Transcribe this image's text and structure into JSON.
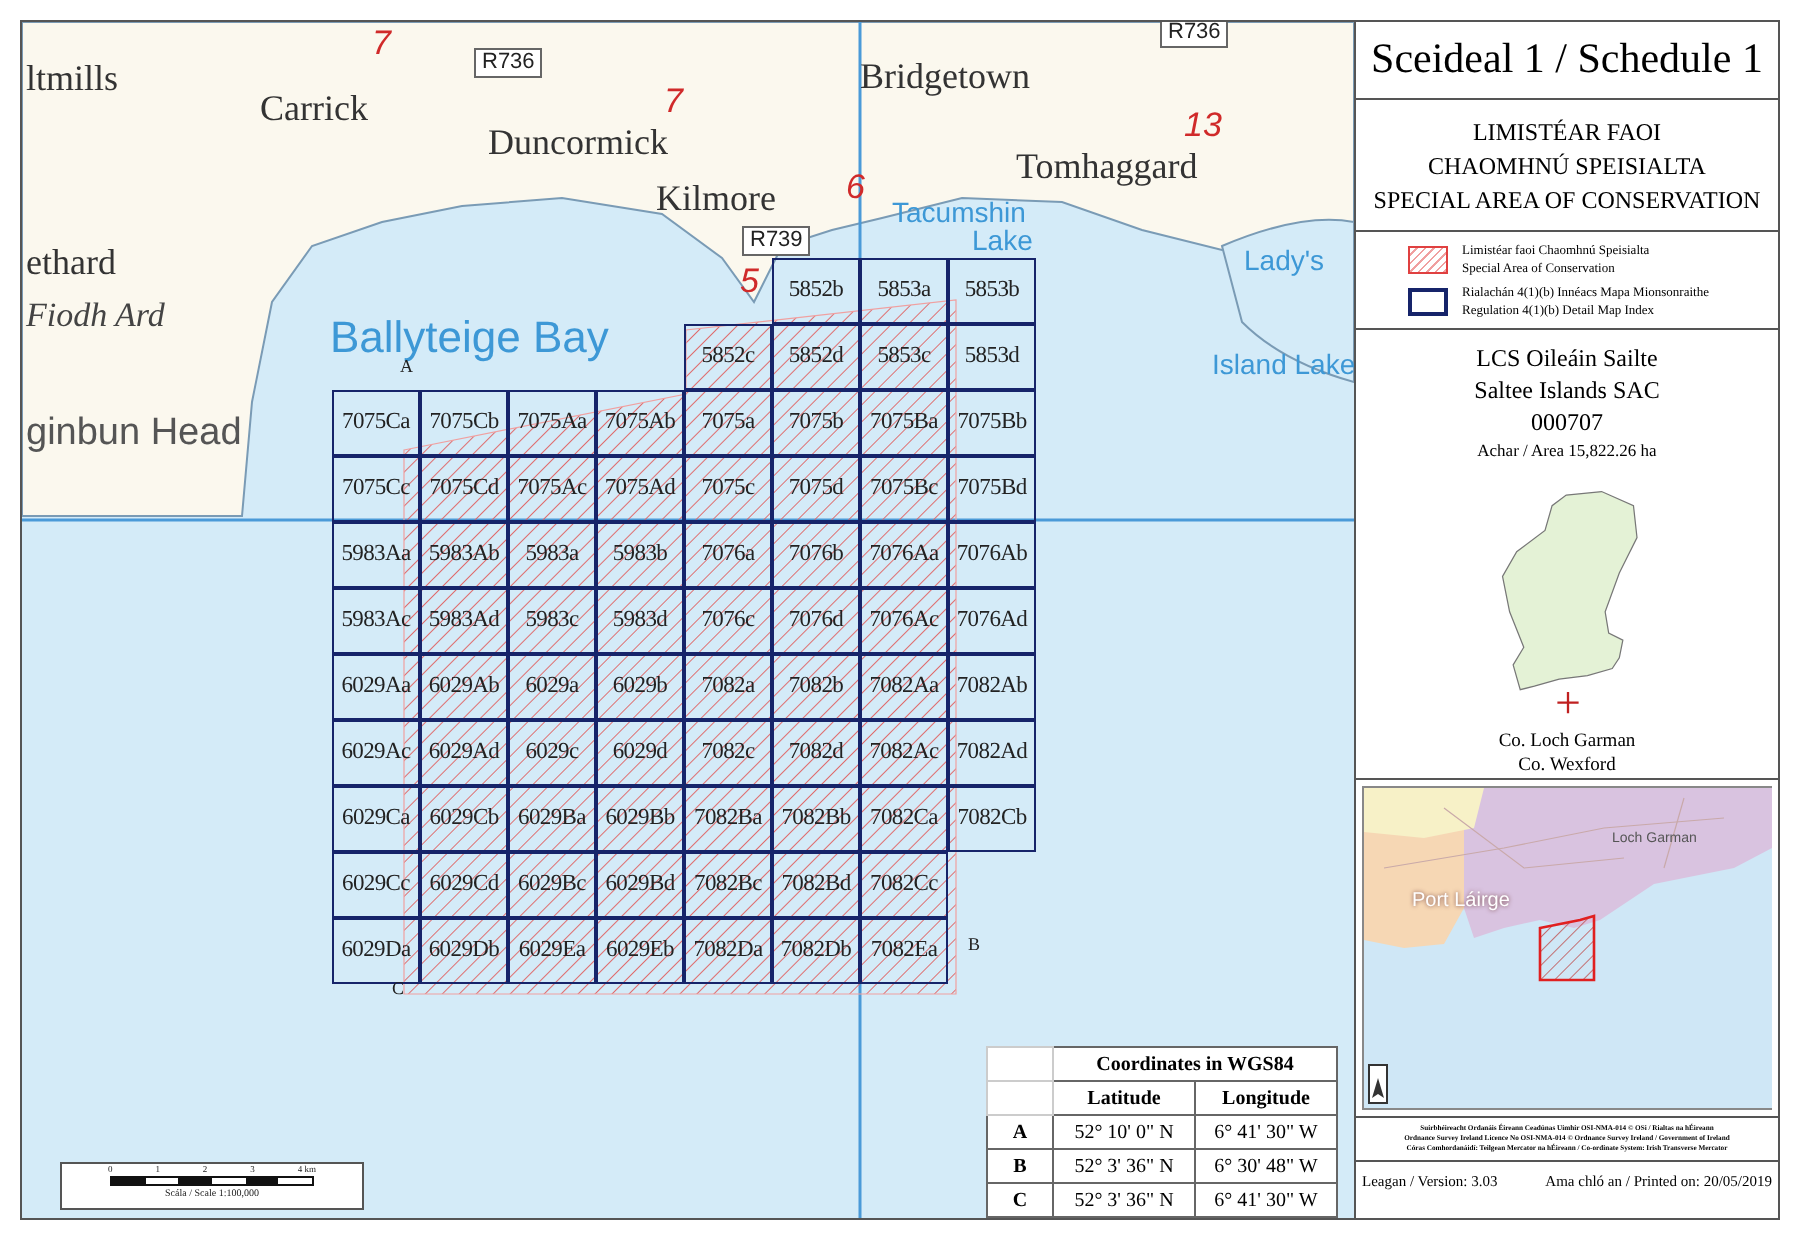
{
  "map": {
    "labels": [
      {
        "kind": "town",
        "text": "ltmills"
      },
      {
        "kind": "town",
        "text": "Carrick"
      },
      {
        "kind": "town",
        "text": "Duncormick"
      },
      {
        "kind": "town",
        "text": "Bridgetown"
      },
      {
        "kind": "town",
        "text": "Kilmore"
      },
      {
        "kind": "town",
        "text": "Tomhaggard"
      },
      {
        "kind": "town",
        "text": "ethard"
      },
      {
        "kind": "irish",
        "text": "Fiodh Ard"
      },
      {
        "kind": "headland",
        "text": "ginbun Head"
      },
      {
        "kind": "water",
        "text": "Ballyteige Bay"
      },
      {
        "kind": "lake",
        "text": "Tacumshin"
      },
      {
        "kind": "lake",
        "text": "Lake"
      },
      {
        "kind": "lake",
        "text": "Lady's"
      },
      {
        "kind": "lake",
        "text": "Island Lake"
      },
      {
        "kind": "road",
        "text": "R736"
      },
      {
        "kind": "road",
        "text": "R736"
      },
      {
        "kind": "road",
        "text": "R739"
      },
      {
        "kind": "number",
        "text": "7"
      },
      {
        "kind": "number",
        "text": "7"
      },
      {
        "kind": "number",
        "text": "6"
      },
      {
        "kind": "number",
        "text": "13"
      },
      {
        "kind": "number",
        "text": "5"
      },
      {
        "kind": "corner",
        "text": "A"
      },
      {
        "kind": "corner",
        "text": "B"
      },
      {
        "kind": "corner",
        "text": "C"
      }
    ],
    "grid": {
      "rows": [
        [
          "",
          "",
          "",
          "",
          "",
          "5852b",
          "5853a",
          "5853b"
        ],
        [
          "",
          "",
          "",
          "",
          "5852c",
          "5852d",
          "5853c",
          "5853d"
        ],
        [
          "7075Ca",
          "7075Cb",
          "7075Aa",
          "7075Ab",
          "7075a",
          "7075b",
          "7075Ba",
          "7075Bb"
        ],
        [
          "7075Cc",
          "7075Cd",
          "7075Ac",
          "7075Ad",
          "7075c",
          "7075d",
          "7075Bc",
          "7075Bd"
        ],
        [
          "5983Aa",
          "5983Ab",
          "5983a",
          "5983b",
          "7076a",
          "7076b",
          "7076Aa",
          "7076Ab"
        ],
        [
          "5983Ac",
          "5983Ad",
          "5983c",
          "5983d",
          "7076c",
          "7076d",
          "7076Ac",
          "7076Ad"
        ],
        [
          "6029Aa",
          "6029Ab",
          "6029a",
          "6029b",
          "7082a",
          "7082b",
          "7082Aa",
          "7082Ab"
        ],
        [
          "6029Ac",
          "6029Ad",
          "6029c",
          "6029d",
          "7082c",
          "7082d",
          "7082Ac",
          "7082Ad"
        ],
        [
          "6029Ca",
          "6029Cb",
          "6029Ba",
          "6029Bb",
          "7082Ba",
          "7082Bb",
          "7082Ca",
          "7082Cb"
        ],
        [
          "6029Cc",
          "6029Cd",
          "6029Bc",
          "6029Bd",
          "7082Bc",
          "7082Bd",
          "7082Cc",
          ""
        ],
        [
          "6029Da",
          "6029Db",
          "6029Ea",
          "6029Eb",
          "7082Da",
          "7082Db",
          "7082Ea",
          ""
        ]
      ]
    },
    "scale": {
      "ticks": [
        "0",
        "1",
        "2",
        "3",
        "4 km"
      ],
      "caption": "Scála / Scale 1:100,000"
    },
    "coordinates": {
      "title": "Coordinates in WGS84",
      "columns": [
        "Latitude",
        "Longitude"
      ],
      "rows": [
        {
          "point": "A",
          "latitude": "52° 10' 0\" N",
          "longitude": "6° 41' 30\" W"
        },
        {
          "point": "B",
          "latitude": "52° 3' 36\" N",
          "longitude": "6° 30' 48\" W"
        },
        {
          "point": "C",
          "latitude": "52° 3' 36\" N",
          "longitude": "6° 41' 30\" W"
        }
      ]
    }
  },
  "schedule_title": "Sceideal 1 / Schedule 1",
  "designation": [
    "LIMISTÉAR FAOI",
    "CHAOMHNÚ SPEISIALTA",
    "SPECIAL AREA OF CONSERVATION"
  ],
  "legend": [
    {
      "kind": "hatched",
      "lines": [
        "Limistéar faoi Chaomhnú Speisialta",
        "Special Area of Conservation"
      ]
    },
    {
      "kind": "outline",
      "lines": [
        "Rialachán 4(1)(b) Innéacs Mapa Mionsonraithe",
        "Regulation 4(1)(b) Detail Map Index"
      ]
    }
  ],
  "site": {
    "name_irish": "LCS Oileáin Sailte",
    "name_english": "Saltee Islands SAC",
    "code": "000707",
    "area": "Achar / Area 15,822.26 ha"
  },
  "county": [
    "Co. Loch Garman",
    "Co. Wexford"
  ],
  "locator_map": {
    "labels": [
      "Loch Garman",
      "Port Láirge"
    ]
  },
  "credits": [
    "Suirbhéireacht Ordanáis Éireann Ceadúnas Uimhir OSI-NMA-014 © OSi / Rialtas na hÉireann",
    "Ordnance Survey Ireland Licence No OSI-NMA-014 © Ordnance Survey Ireland / Government of Ireland",
    "Córas Comhordanáidí: Teilgean Mercator na hÉireann / Co-ordinate System: Irish Transverse Mercator"
  ],
  "version": "Leagan / Version: 3.03",
  "printed": "Ama chló an / Printed on: 20/05/2019"
}
